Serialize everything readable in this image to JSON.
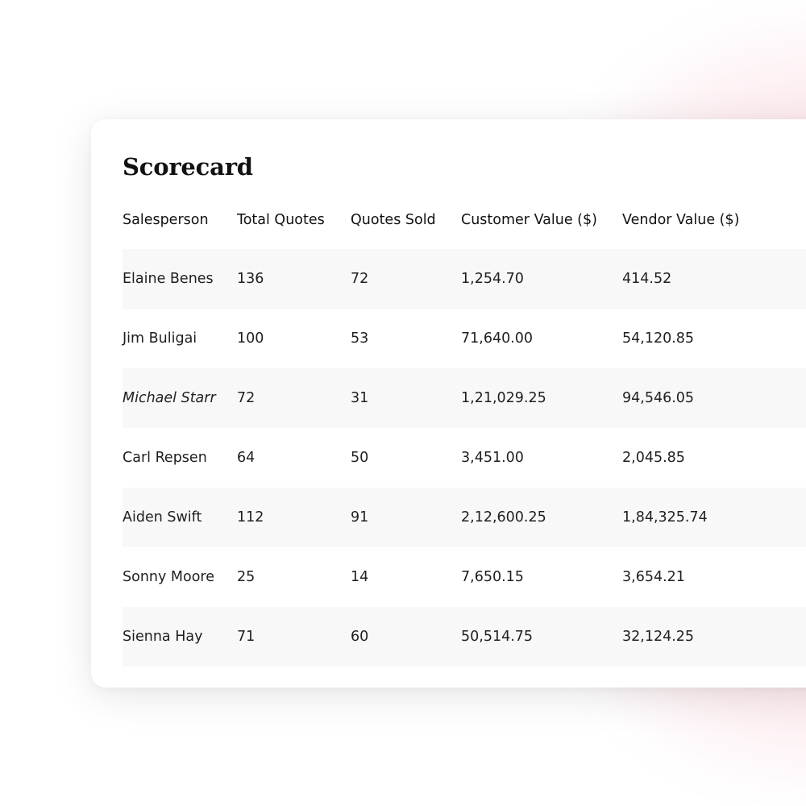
{
  "scorecard": {
    "title": "Scorecard",
    "columns": [
      "Salesperson",
      "Total Quotes",
      "Quotes Sold",
      "Customer Value ($)",
      "Vendor Value ($)"
    ],
    "rows": [
      {
        "salesperson": "Elaine Benes",
        "total_quotes": "136",
        "quotes_sold": "72",
        "customer_value": "1,254.70",
        "vendor_value": "414.52"
      },
      {
        "salesperson": "Jim Buligai",
        "total_quotes": "100",
        "quotes_sold": "53",
        "customer_value": "71,640.00",
        "vendor_value": "54,120.85"
      },
      {
        "salesperson": "Michael Starr",
        "total_quotes": "72",
        "quotes_sold": "31",
        "customer_value": "1,21,029.25",
        "vendor_value": "94,546.05",
        "italic": true
      },
      {
        "salesperson": "Carl Repsen",
        "total_quotes": "64",
        "quotes_sold": "50",
        "customer_value": "3,451.00",
        "vendor_value": "2,045.85"
      },
      {
        "salesperson": "Aiden Swift",
        "total_quotes": "112",
        "quotes_sold": "91",
        "customer_value": "2,12,600.25",
        "vendor_value": "1,84,325.74"
      },
      {
        "salesperson": "Sonny Moore",
        "total_quotes": "25",
        "quotes_sold": "14",
        "customer_value": "7,650.15",
        "vendor_value": "3,654.21"
      },
      {
        "salesperson": "Sienna Hay",
        "total_quotes": "71",
        "quotes_sold": "60",
        "customer_value": "50,514.75",
        "vendor_value": "32,124.25"
      }
    ]
  },
  "colors": {
    "background": "#ffffff",
    "card": "#ffffff",
    "row_stripe": "#f8f8f8",
    "glow": "#ec7891",
    "text": "#1a1a1a"
  }
}
